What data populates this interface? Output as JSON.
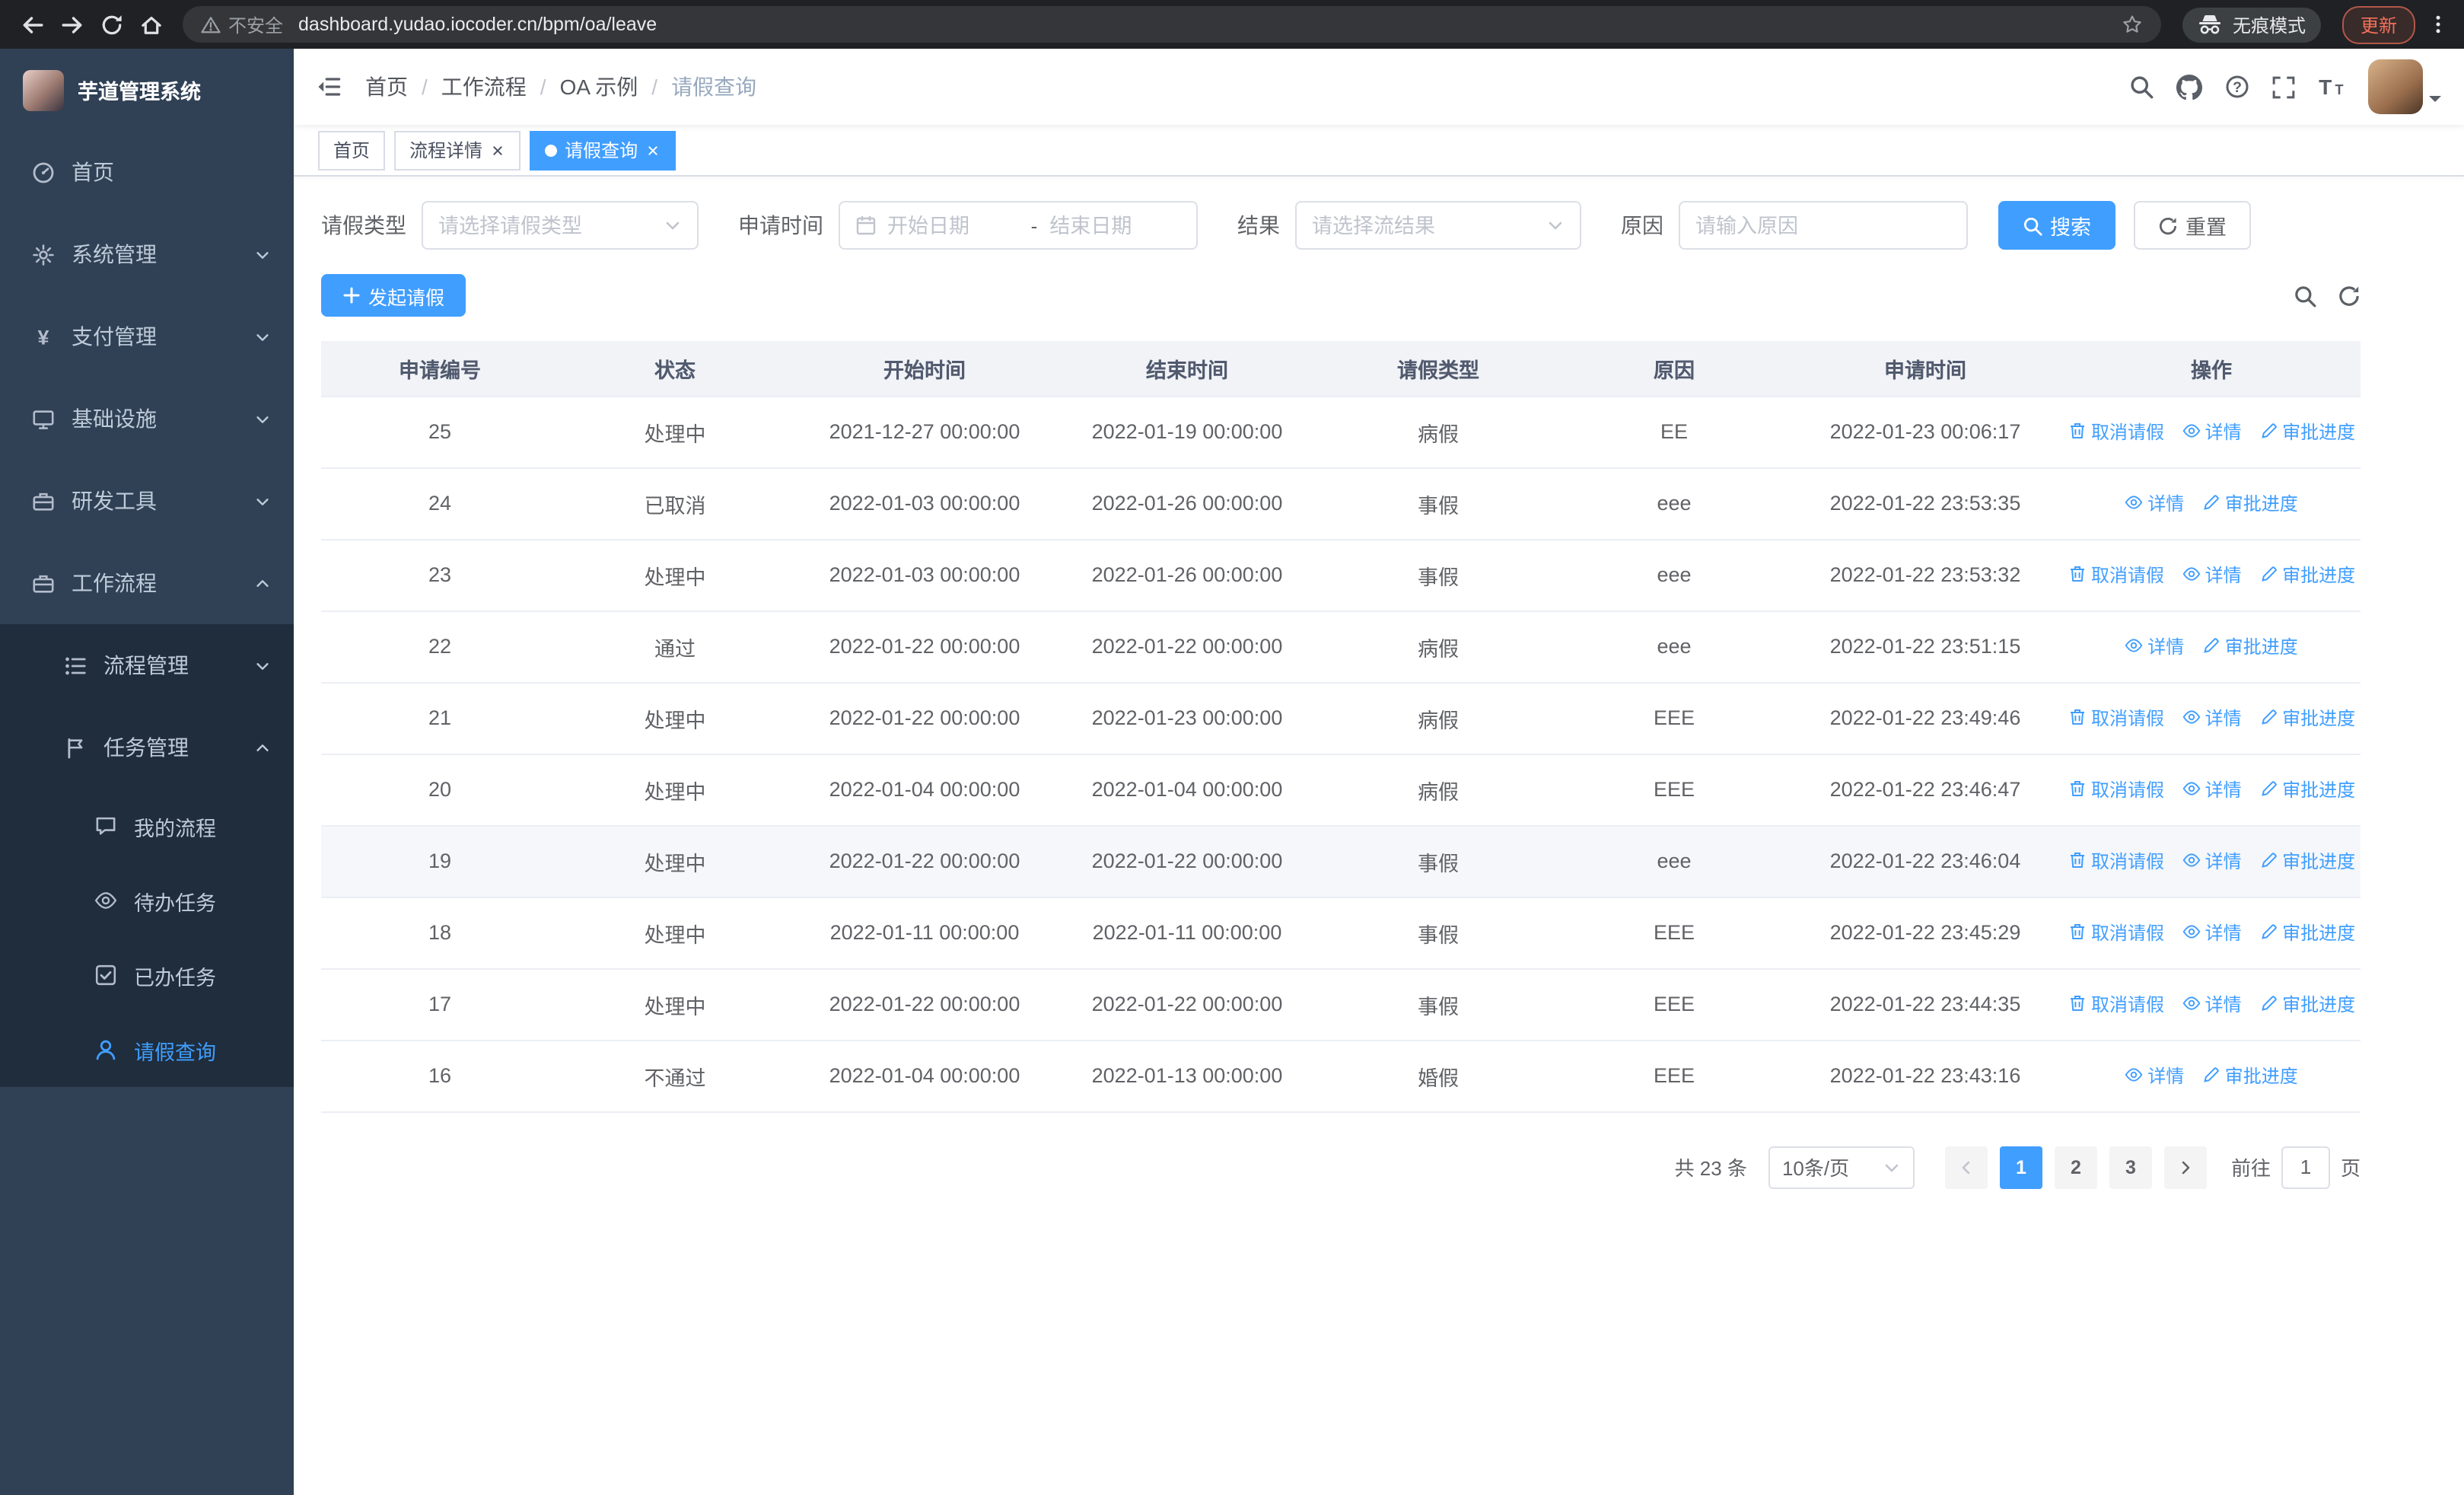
{
  "browser": {
    "security_label": "不安全",
    "url": "dashboard.yudao.iocoder.cn/bpm/oa/leave",
    "incognito_label": "无痕模式",
    "update_label": "更新"
  },
  "sidebar": {
    "logo_title": "芋道管理系统",
    "items": {
      "home": "首页",
      "system": "系统管理",
      "payment": "支付管理",
      "infra": "基础设施",
      "dev_tools": "研发工具",
      "workflow": "工作流程",
      "process_mgmt": "流程管理",
      "task_mgmt": "任务管理",
      "my_process": "我的流程",
      "todo_tasks": "待办任务",
      "done_tasks": "已办任务",
      "leave_query": "请假查询"
    }
  },
  "navbar": {
    "breadcrumb": [
      "首页",
      "工作流程",
      "OA 示例",
      "请假查询"
    ]
  },
  "tabs": [
    {
      "label": "首页"
    },
    {
      "label": "流程详情"
    },
    {
      "label": "请假查询"
    }
  ],
  "filters": {
    "leave_type_label": "请假类型",
    "leave_type_placeholder": "请选择请假类型",
    "apply_time_label": "申请时间",
    "start_date_placeholder": "开始日期",
    "range_separator": "-",
    "end_date_placeholder": "结束日期",
    "result_label": "结果",
    "result_placeholder": "请选择流结果",
    "reason_label": "原因",
    "reason_placeholder": "请输入原因",
    "search_button": "搜索",
    "reset_button": "重置"
  },
  "toolbar": {
    "create_button": "发起请假"
  },
  "table": {
    "headers": [
      "申请编号",
      "状态",
      "开始时间",
      "结束时间",
      "请假类型",
      "原因",
      "申请时间",
      "操作"
    ],
    "action_labels": {
      "cancel": "取消请假",
      "detail": "详情",
      "progress": "审批进度"
    },
    "rows": [
      {
        "id": "25",
        "status": "处理中",
        "start": "2021-12-27 00:00:00",
        "end": "2022-01-19 00:00:00",
        "type": "病假",
        "reason": "EE",
        "apply_time": "2022-01-23 00:06:17"
      },
      {
        "id": "24",
        "status": "已取消",
        "start": "2022-01-03 00:00:00",
        "end": "2022-01-26 00:00:00",
        "type": "事假",
        "reason": "eee",
        "apply_time": "2022-01-22 23:53:35"
      },
      {
        "id": "23",
        "status": "处理中",
        "start": "2022-01-03 00:00:00",
        "end": "2022-01-26 00:00:00",
        "type": "事假",
        "reason": "eee",
        "apply_time": "2022-01-22 23:53:32"
      },
      {
        "id": "22",
        "status": "通过",
        "start": "2022-01-22 00:00:00",
        "end": "2022-01-22 00:00:00",
        "type": "病假",
        "reason": "eee",
        "apply_time": "2022-01-22 23:51:15"
      },
      {
        "id": "21",
        "status": "处理中",
        "start": "2022-01-22 00:00:00",
        "end": "2022-01-23 00:00:00",
        "type": "病假",
        "reason": "EEE",
        "apply_time": "2022-01-22 23:49:46"
      },
      {
        "id": "20",
        "status": "处理中",
        "start": "2022-01-04 00:00:00",
        "end": "2022-01-04 00:00:00",
        "type": "病假",
        "reason": "EEE",
        "apply_time": "2022-01-22 23:46:47"
      },
      {
        "id": "19",
        "status": "处理中",
        "start": "2022-01-22 00:00:00",
        "end": "2022-01-22 00:00:00",
        "type": "事假",
        "reason": "eee",
        "apply_time": "2022-01-22 23:46:04"
      },
      {
        "id": "18",
        "status": "处理中",
        "start": "2022-01-11 00:00:00",
        "end": "2022-01-11 00:00:00",
        "type": "事假",
        "reason": "EEE",
        "apply_time": "2022-01-22 23:45:29"
      },
      {
        "id": "17",
        "status": "处理中",
        "start": "2022-01-22 00:00:00",
        "end": "2022-01-22 00:00:00",
        "type": "事假",
        "reason": "EEE",
        "apply_time": "2022-01-22 23:44:35"
      },
      {
        "id": "16",
        "status": "不通过",
        "start": "2022-01-04 00:00:00",
        "end": "2022-01-13 00:00:00",
        "type": "婚假",
        "reason": "EEE",
        "apply_time": "2022-01-22 23:43:16"
      }
    ]
  },
  "pagination": {
    "total_label": "共 23 条",
    "page_size": "10条/页",
    "pages": [
      "1",
      "2",
      "3"
    ],
    "current_page": "1",
    "goto_label": "前往",
    "goto_value": "1",
    "page_unit_label": "页"
  },
  "colors": {
    "primary": "#409eff",
    "sidebar_bg": "#304156",
    "sidebar_submenu_bg": "#1f2d3d",
    "sidebar_text": "#bfcbd9",
    "browser_chrome_bg": "#202124",
    "update_chip_text": "#f0705a"
  },
  "icons": {
    "browser": [
      "back-icon",
      "forward-icon",
      "reload-icon",
      "home-icon",
      "warning-icon",
      "star-icon",
      "incognito-icon",
      "kebab-menu-icon"
    ],
    "navbar": [
      "sidebar-fold-icon",
      "search-icon",
      "github-icon",
      "help-icon",
      "fullscreen-icon",
      "font-size-icon",
      "caret-down-icon"
    ],
    "sidebar": [
      "dashboard-icon",
      "gear-icon",
      "yen-icon",
      "monitor-icon",
      "briefcase-icon",
      "tree-list-icon",
      "flag-icon",
      "chat-icon",
      "eye-icon",
      "check-square-icon",
      "user-icon",
      "chevron-down-icon"
    ],
    "filters": [
      "chevron-down-icon",
      "calendar-icon",
      "search-icon",
      "refresh-icon",
      "plus-icon"
    ],
    "table_actions": [
      "delete-icon",
      "view-icon",
      "edit-icon"
    ]
  }
}
